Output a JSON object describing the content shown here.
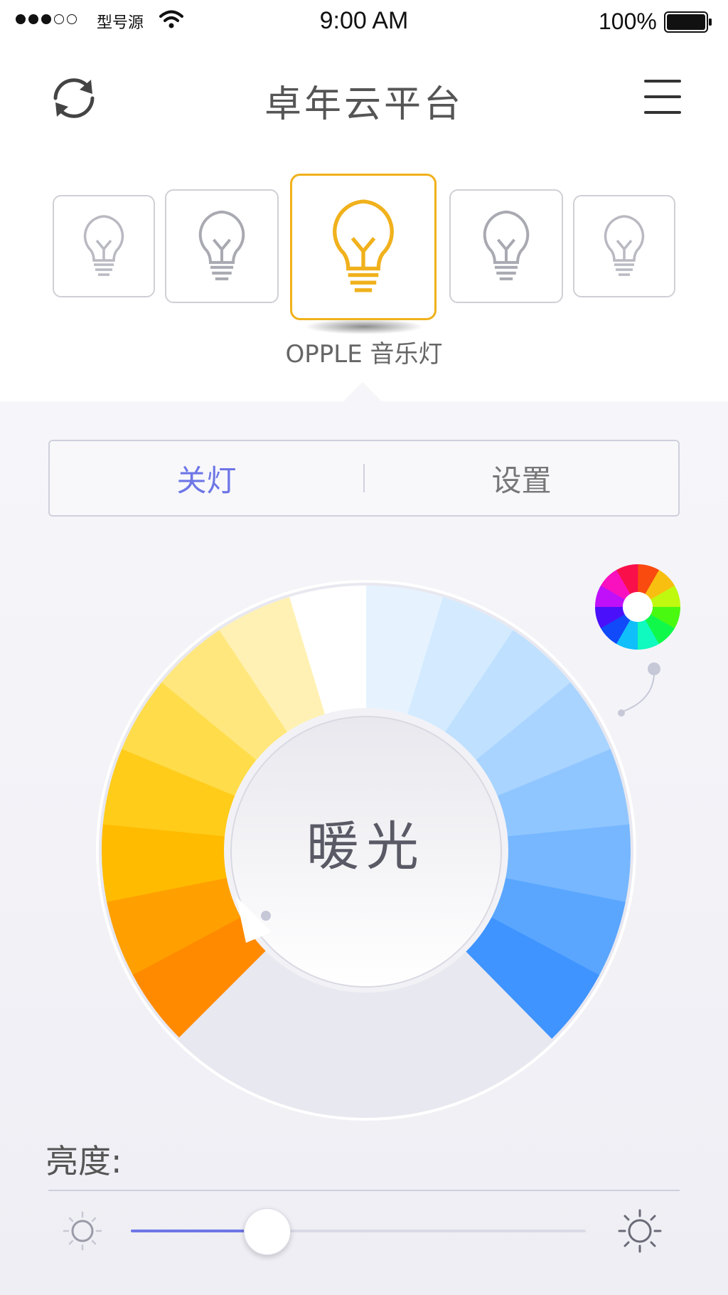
{
  "status_bar": {
    "carrier": "型号源",
    "time": "9:00 AM",
    "battery": "100%",
    "signal_bars_filled": 3,
    "signal_bars_total": 5
  },
  "nav": {
    "title": "卓年云平台",
    "refresh_icon": "refresh-icon",
    "menu_icon": "hamburger-menu-icon"
  },
  "devices": {
    "selected_name": "OPPLE 音乐灯",
    "selected_index": 2,
    "count": 5,
    "active_color": "#f0b11c",
    "inactive_color": "#b9b9c2"
  },
  "controls": {
    "off_label": "关灯",
    "settings_label": "设置",
    "accent": "#6e76e6"
  },
  "dial": {
    "label": "暖光",
    "warm_colors": [
      "#ff8a00",
      "#ffa000",
      "#ffbb00",
      "#ffcc1a",
      "#ffdc4a",
      "#ffe77d",
      "#fff1b3",
      "#ffffff"
    ],
    "cool_colors": [
      "#e6f3ff",
      "#d4ebff",
      "#bfe0ff",
      "#a9d4ff",
      "#90c6ff",
      "#76b7ff",
      "#5aa6ff",
      "#3f94ff"
    ]
  },
  "brightness": {
    "label": "亮度:",
    "value": 0.3,
    "low_icon": "sun-dim-icon",
    "high_icon": "sun-bright-icon"
  }
}
